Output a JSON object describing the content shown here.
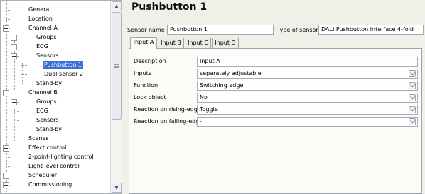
{
  "tree": {
    "items": [
      {
        "label": "General",
        "indent": 0,
        "expander": "none"
      },
      {
        "label": "Location",
        "indent": 0,
        "expander": "none"
      },
      {
        "label": "Channel A",
        "indent": 0,
        "expander": "minus"
      },
      {
        "label": "Groups",
        "indent": 1,
        "expander": "plus"
      },
      {
        "label": "ECG",
        "indent": 1,
        "expander": "plus"
      },
      {
        "label": "Sensors",
        "indent": 1,
        "expander": "minus"
      },
      {
        "label": "Pushbutton 1",
        "indent": 2,
        "expander": "none",
        "selected": true
      },
      {
        "label": "Dual sensor 2",
        "indent": 2,
        "expander": "none"
      },
      {
        "label": "Stand-by",
        "indent": 1,
        "expander": "none"
      },
      {
        "label": "Channel B",
        "indent": 0,
        "expander": "minus"
      },
      {
        "label": "Groups",
        "indent": 1,
        "expander": "plus"
      },
      {
        "label": "ECG",
        "indent": 1,
        "expander": "none"
      },
      {
        "label": "Sensors",
        "indent": 1,
        "expander": "none"
      },
      {
        "label": "Stand-by",
        "indent": 1,
        "expander": "none"
      },
      {
        "label": "Scenes",
        "indent": 0,
        "expander": "none"
      },
      {
        "label": "Effect control",
        "indent": 0,
        "expander": "plus"
      },
      {
        "label": "2-point-lighting control",
        "indent": 0,
        "expander": "none"
      },
      {
        "label": "Light level control",
        "indent": 0,
        "expander": "none"
      },
      {
        "label": "Scheduler",
        "indent": 0,
        "expander": "plus"
      },
      {
        "label": "Commissioning",
        "indent": 0,
        "expander": "plus"
      }
    ],
    "scroll_up_icon": "arrow-up-icon",
    "scroll_down_icon": "arrow-down-icon"
  },
  "page": {
    "title": "Pushbutton 1",
    "sensor_name_label": "Sensor name",
    "sensor_name_value": "Pushbutton 1",
    "sensor_type_label": "Type of sensor:",
    "sensor_type_value": "DALI Pushbutton interface 4-fold"
  },
  "tabs": [
    {
      "label": "Input A",
      "active": true
    },
    {
      "label": "Input B",
      "active": false
    },
    {
      "label": "Input C",
      "active": false
    },
    {
      "label": "Input D",
      "active": false
    }
  ],
  "params": [
    {
      "name": "Description",
      "value": "Input A",
      "type": "text"
    },
    {
      "name": "Inputs",
      "value": "separately adjustable",
      "type": "select"
    },
    {
      "name": "Function",
      "value": "Switching edge",
      "type": "select"
    },
    {
      "name": "Lock object",
      "value": "No",
      "type": "select"
    },
    {
      "name": "Reaction on rising-edge",
      "value": "Toggle",
      "type": "select"
    },
    {
      "name": "Reaction on falling-edge",
      "value": "-",
      "type": "select"
    }
  ],
  "colors": {
    "selection": "#3d6fd6",
    "panel_background": "#f0efe8",
    "tab_background": "#fbfbf8"
  }
}
